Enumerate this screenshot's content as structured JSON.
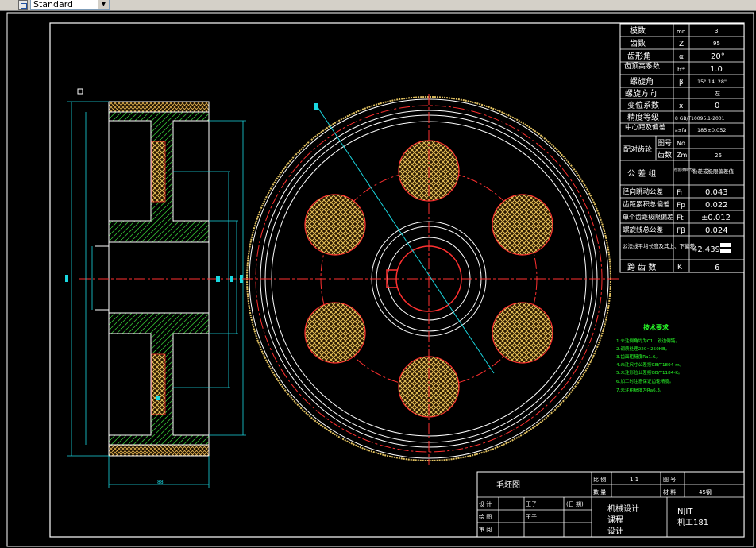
{
  "toolbar": {
    "textstyle_value": "Standard",
    "textstyle_icon": "text-style-icon"
  },
  "params": [
    {
      "label": "模数",
      "sym": "mn",
      "val": "3"
    },
    {
      "label": "齿数",
      "sym": "Z",
      "val": "95"
    },
    {
      "label": "齿形角",
      "sym": "α",
      "val": "20°"
    },
    {
      "label": "齿顶高系数",
      "sym": "h*",
      "val": "1.0"
    },
    {
      "label": "螺旋角",
      "sym": "β",
      "val": "15° 14' 28\""
    },
    {
      "label": "螺旋方向",
      "sym": "",
      "val": "左"
    },
    {
      "label": "变位系数",
      "sym": "x",
      "val": "0"
    },
    {
      "label": "精度等级",
      "sym": "",
      "val": "8 GB/T10095.1-2001"
    },
    {
      "label": "中心距及偏差",
      "sym": "a±fa",
      "val": "185±0.052"
    }
  ],
  "mating": {
    "label": "配对齿轮",
    "rows": [
      {
        "label": "图号",
        "sym": "No",
        "val": ""
      },
      {
        "label": "齿数",
        "sym": "Zm",
        "val": "26"
      }
    ]
  },
  "tolerance_header": {
    "label": "公 差 组",
    "code": "检验项目代号",
    "val": "公差或极限偏差值"
  },
  "tolerances": [
    {
      "label": "径向跳动公差",
      "sym": "Fr",
      "val": "0.043"
    },
    {
      "label": "齿距累积总偏差",
      "sym": "Fp",
      "val": "0.022"
    },
    {
      "label": "单个齿距极限偏差",
      "sym": "Ft",
      "val": "±0.012"
    },
    {
      "label": "螺旋线总公差",
      "sym": "Fβ",
      "val": "0.024"
    }
  ],
  "span": [
    {
      "label": "公法线平均长度及其上、下偏差",
      "sym": "",
      "val": "42.439"
    },
    {
      "label": "跨 齿 数",
      "sym": "K",
      "val": "6"
    }
  ],
  "tech_req": {
    "title": "技术要求",
    "items": [
      "1.未注倒角均为C1，锐边倒钝。",
      "2.调质处理220~250HB。",
      "3.齿面粗糙度Ra1.6。",
      "4.未注尺寸公差按GB/T1804-m。",
      "5.未注形位公差按GB/T1184-K。",
      "6.加工时注意保证齿轮精度。",
      "7.未注粗糙度为Ra6.3。"
    ]
  },
  "title_block": {
    "drawing_name": "毛坯图",
    "scale_label": "比 例",
    "scale_val": "1:1",
    "no_label": "图 号",
    "no_val": "",
    "qty_label": "数 量",
    "qty_val": "",
    "mat_label": "材 料",
    "mat_val": "45钢",
    "rows": [
      {
        "role": "设 计",
        "name": "王子",
        "date": "(日 期)"
      },
      {
        "role": "绘 图",
        "name": "王子",
        "date": ""
      },
      {
        "role": "审 阅",
        "name": "",
        "date": ""
      }
    ],
    "course": "机械设计课程设计",
    "school": "NJIT",
    "class": "机工181"
  },
  "dims": {
    "width_label": "88"
  }
}
